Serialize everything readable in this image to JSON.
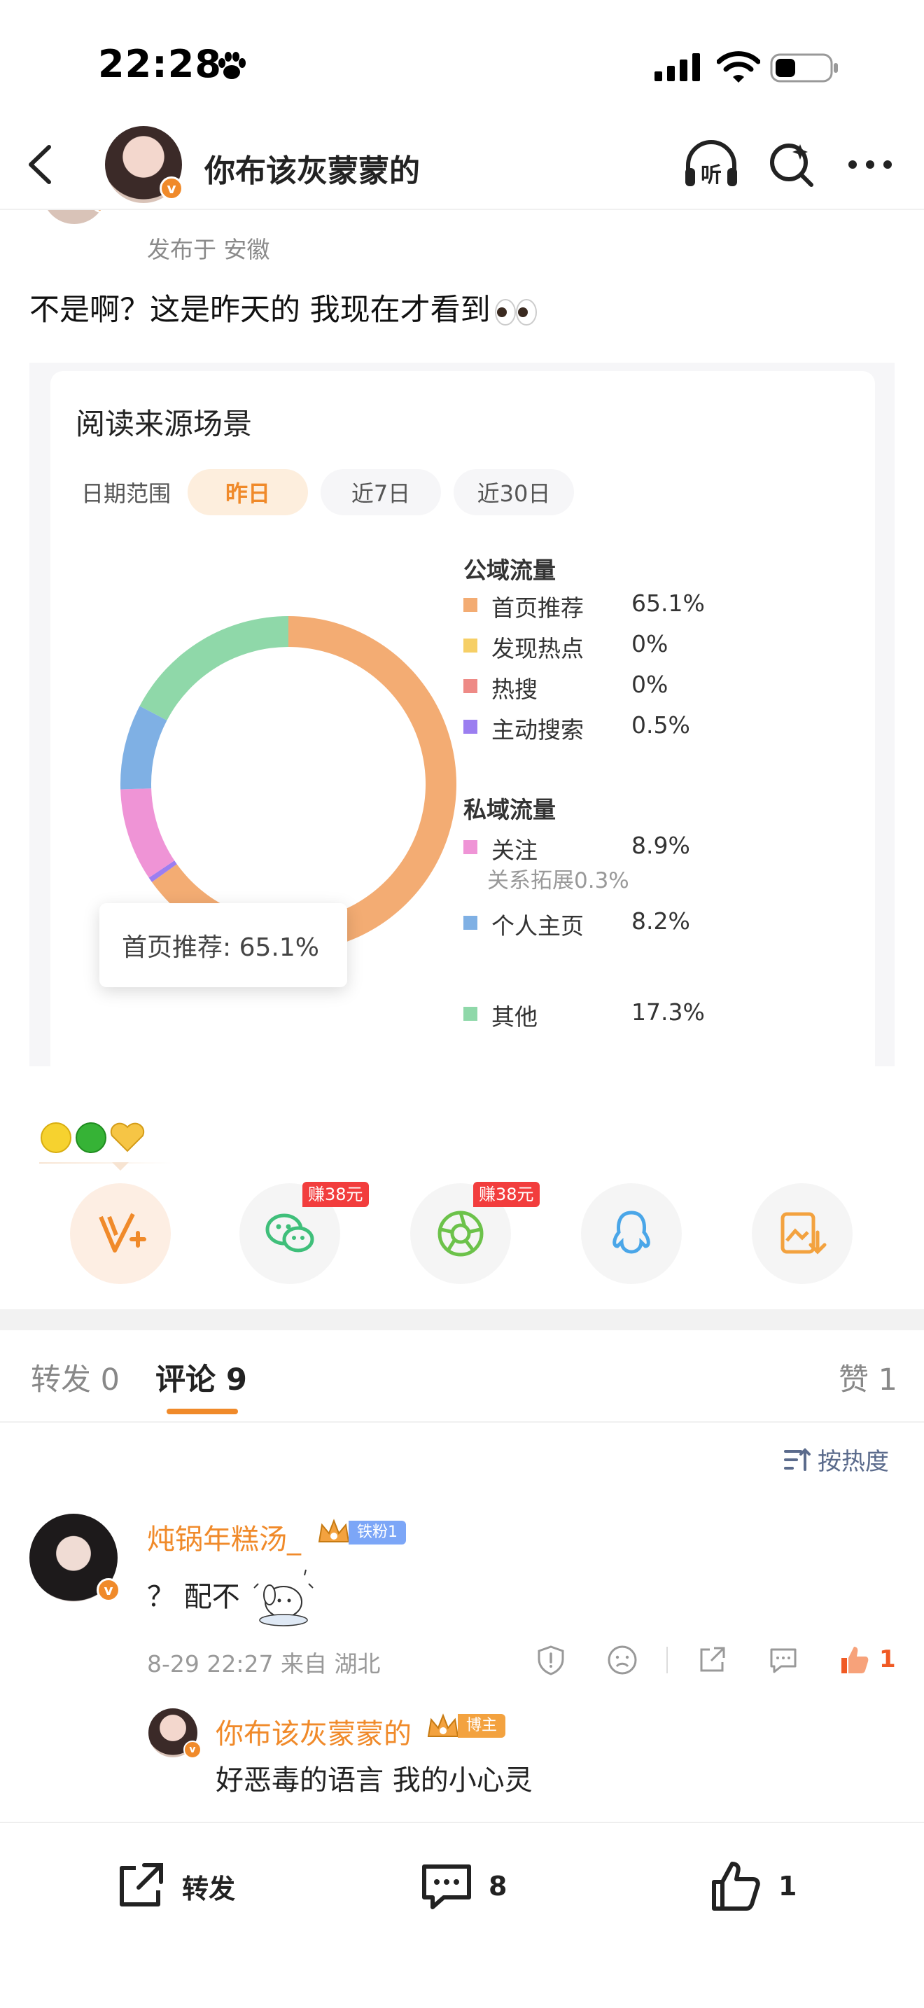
{
  "status_bar": {
    "time": "22:28"
  },
  "nav": {
    "title": "你布该灰蒙蒙的",
    "listen_label": "听"
  },
  "post": {
    "location": "发布于 安徽",
    "text": "不是啊？这是昨天的 我现在才看到"
  },
  "card": {
    "title": "阅读来源场景",
    "range_label": "日期范围",
    "range_options": [
      "昨日",
      "近7日",
      "近30日"
    ],
    "selected_range": "昨日",
    "tooltip": "首页推荐: 65.1%",
    "public_head": "公域流量",
    "private_head": "私域流量",
    "legend": [
      {
        "name": "首页推荐",
        "value": "65.1%",
        "color": "#f3ac73"
      },
      {
        "name": "发现热点",
        "value": "0%",
        "color": "#f6cf66"
      },
      {
        "name": "热搜",
        "value": "0%",
        "color": "#ee8a86"
      },
      {
        "name": "主动搜索",
        "value": "0.5%",
        "color": "#9b7ef0"
      },
      {
        "name": "关注",
        "value": "8.9%",
        "color": "#ef94d6"
      },
      {
        "name": "个人主页",
        "value": "8.2%",
        "color": "#7fb0e4"
      },
      {
        "name": "其他",
        "value": "17.3%",
        "color": "#8fd8a9"
      }
    ],
    "follow_sub": "关系拓展0.3%"
  },
  "chart_data": {
    "type": "pie",
    "title": "阅读来源场景",
    "categories": [
      "首页推荐",
      "发现热点",
      "热搜",
      "主动搜索",
      "关注",
      "个人主页",
      "其他"
    ],
    "values": [
      65.1,
      0,
      0,
      0.5,
      8.9,
      8.2,
      17.3
    ],
    "colors": [
      "#f3ac73",
      "#f6cf66",
      "#ee8a86",
      "#9b7ef0",
      "#ef94d6",
      "#7fb0e4",
      "#8fd8a9"
    ],
    "donut": true,
    "highlighted": "首页推荐"
  },
  "share": {
    "earn_badge_1": "赚38元",
    "earn_badge_2": "赚38元"
  },
  "tabs": {
    "repost": "转发 0",
    "comments": "评论 9",
    "likes": "赞 1",
    "sort": "按热度"
  },
  "comment": {
    "user": "炖锅年糕汤_",
    "badge": "铁粉1",
    "text": "？ 配不",
    "meta": "8-29 22:27 来自 湖北",
    "likes": "1"
  },
  "reply": {
    "user": "你布该灰蒙蒙的",
    "badge": "博主",
    "text": "好恶毒的语言 我的小心灵"
  },
  "bottom": {
    "repost": "转发",
    "comment_count": "8",
    "like_count": "1"
  },
  "colors": {
    "accent": "#f08a2a",
    "like_red": "#f05a24",
    "link_blue": "#5b6b8c"
  }
}
